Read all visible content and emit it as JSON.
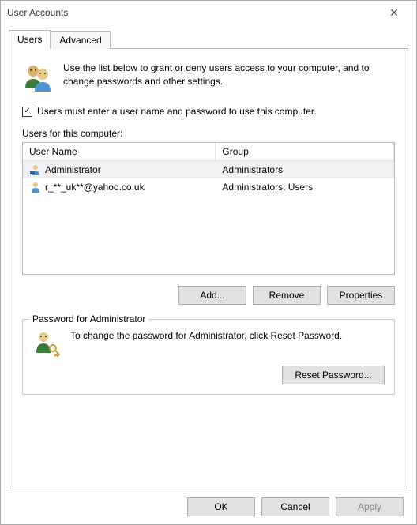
{
  "window": {
    "title": "User Accounts",
    "close_label": "✕"
  },
  "tabs": {
    "users": "Users",
    "advanced": "Advanced"
  },
  "intro": "Use the list below to grant or deny users access to your computer, and to change passwords and other settings.",
  "checkbox": {
    "checked_glyph": "✓",
    "label": "Users must enter a user name and password to use this computer."
  },
  "list_label": "Users for this computer:",
  "columns": {
    "name": "User Name",
    "group": "Group"
  },
  "rows": [
    {
      "name": "Administrator",
      "group": "Administrators",
      "selected": true
    },
    {
      "name": "r_**_uk**@yahoo.co.uk",
      "group": "Administrators; Users",
      "selected": false
    }
  ],
  "buttons": {
    "add": "Add...",
    "remove": "Remove",
    "properties": "Properties",
    "reset_password": "Reset Password...",
    "ok": "OK",
    "cancel": "Cancel",
    "apply": "Apply"
  },
  "password_box": {
    "legend": "Password for Administrator",
    "text": "To change the password for Administrator, click Reset Password."
  }
}
